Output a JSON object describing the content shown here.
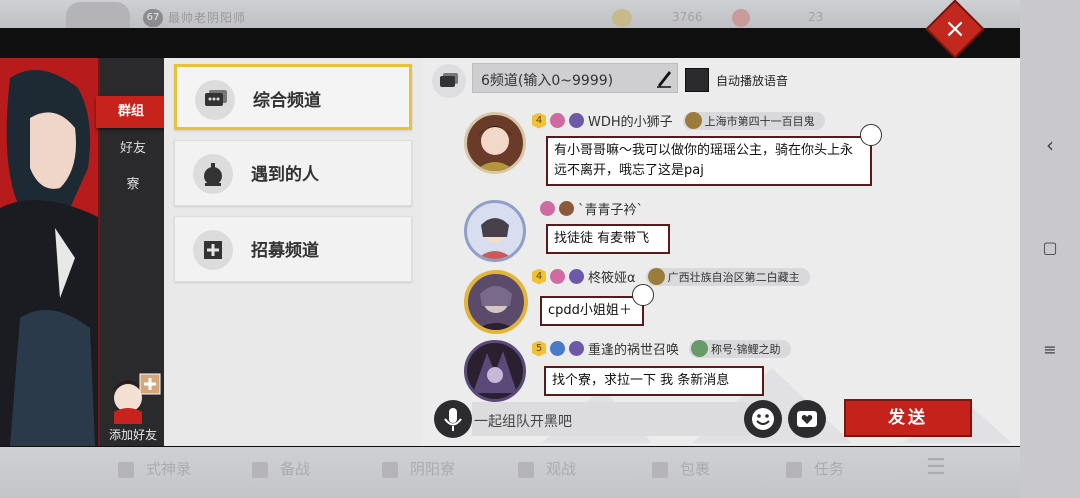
{
  "top_bar": {
    "level": "67",
    "player_name": "最帅老阴阳师",
    "coins": "3766",
    "gems": "23"
  },
  "close_label": "×",
  "left_nav": {
    "tabs": [
      "群组",
      "好友",
      "寮"
    ],
    "add_friend": "添加好友"
  },
  "channels": [
    {
      "name": "综合频道",
      "icon": "chat-bubble-icon",
      "active": true
    },
    {
      "name": "遇到的人",
      "icon": "bell-icon",
      "active": false
    },
    {
      "name": "招募频道",
      "icon": "recruit-plus-icon",
      "active": false
    }
  ],
  "channel_header": {
    "channel_input": "6频道(输入0~9999)",
    "autoplay_label": "自动播放语音"
  },
  "messages": [
    {
      "vip": "4",
      "name": "WDH的小狮子",
      "tag": "上海市第四十一百目鬼",
      "text": "有小哥哥嘛～我可以做你的瑶瑶公主，骑在你头上永远不离开，哦忘了这是paj"
    },
    {
      "vip": "",
      "name": "`青青子衿`",
      "tag": "",
      "text": "找徒徒 有麦带飞"
    },
    {
      "vip": "4",
      "name": "柊筱娅α",
      "tag": "广西壮族自治区第二白藏主",
      "text": "cpdd小姐姐＋"
    },
    {
      "vip": "5",
      "name": "重逢的祸世召唤",
      "tag": "称号·锦鲤之助",
      "text": "找个寮，求拉一下 我 条新消息"
    }
  ],
  "input": {
    "placeholder": "一起组队开黑吧",
    "send_label": "发送"
  },
  "bottom_bar": [
    "式神录",
    "备战",
    "阴阳寮",
    "观战",
    "包裹",
    "任务"
  ],
  "colors": {
    "accent_red": "#c4221b",
    "active_border": "#e8c23a"
  }
}
